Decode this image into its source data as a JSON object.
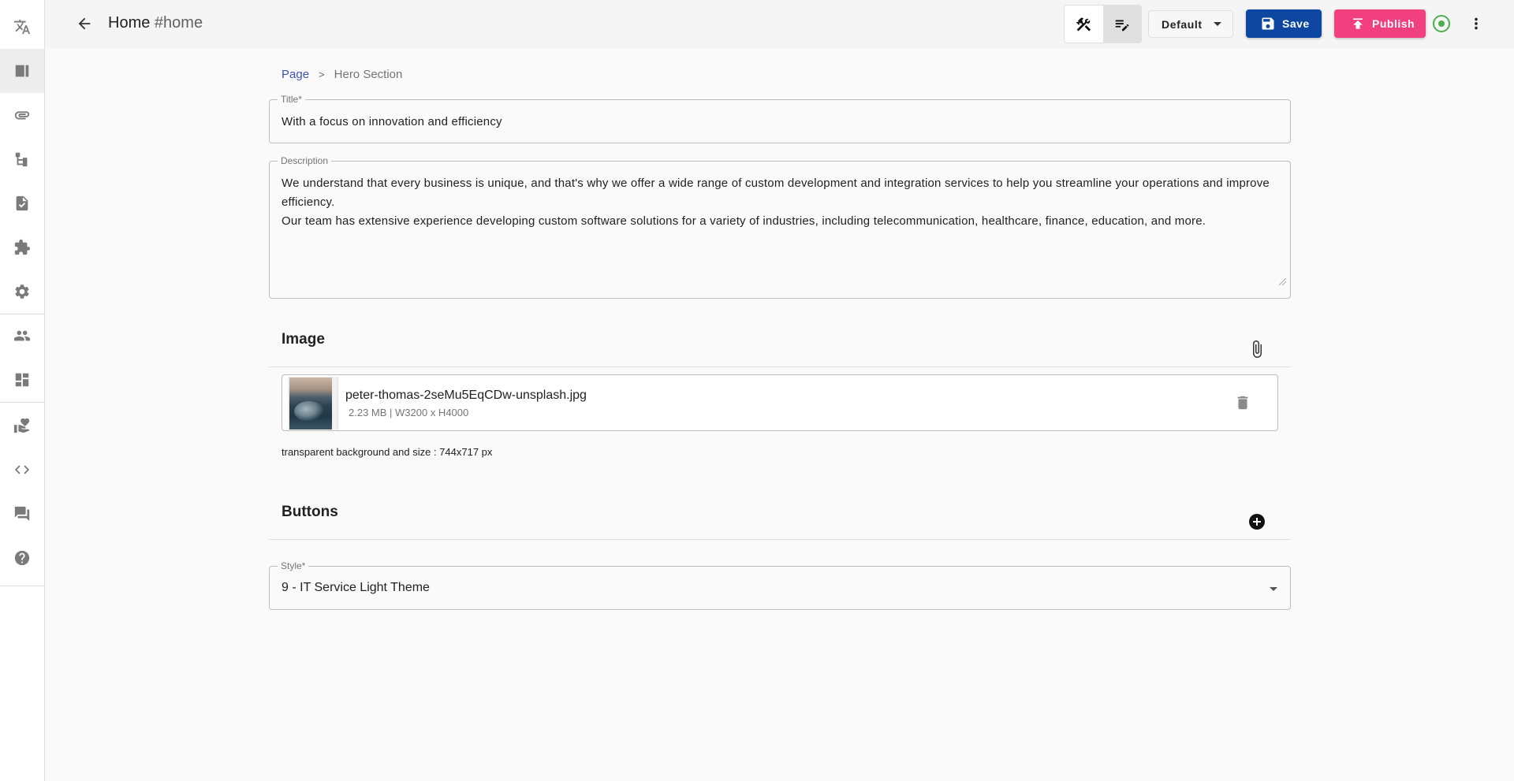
{
  "sidebar": {
    "items": [
      {
        "icon": "translate-icon"
      },
      {
        "icon": "pages-icon"
      },
      {
        "icon": "attachment-icon"
      },
      {
        "icon": "sitemap-icon"
      },
      {
        "icon": "form-check-icon"
      },
      {
        "icon": "puzzle-icon"
      },
      {
        "icon": "gear-icon"
      },
      {
        "icon": "users-icon"
      },
      {
        "icon": "dashboard-icon"
      },
      {
        "icon": "volunteer-icon"
      },
      {
        "icon": "code-icon"
      },
      {
        "icon": "chat-icon"
      },
      {
        "icon": "help-icon"
      }
    ],
    "active_index": 1
  },
  "header": {
    "title": "Home",
    "hash": "#home",
    "variant_select": "Default",
    "save_label": "Save",
    "publish_label": "Publish",
    "colors": {
      "save": "#0d47a1",
      "publish": "#f23f7e",
      "status": "#4caf50"
    }
  },
  "breadcrumb": {
    "root": "Page",
    "separator": ">",
    "current": "Hero Section"
  },
  "form": {
    "title": {
      "label": "Title*",
      "value": "With a focus on innovation and efficiency"
    },
    "description": {
      "label": "Description",
      "line1": "We understand that every business is unique, and that's why we offer a wide range of custom development and integration services to help you streamline your operations and improve efficiency.",
      "line2": "Our team has extensive experience developing custom software solutions for a variety of industries, including telecommunication, healthcare, finance, education, and more."
    },
    "image": {
      "section_title": "Image",
      "file_name": "peter-thomas-2seMu5EqCDw-unsplash.jpg",
      "file_meta": "2.23 MB | W3200 x H4000",
      "helper": "transparent background and size : 744x717 px"
    },
    "buttons": {
      "section_title": "Buttons"
    },
    "style": {
      "label": "Style*",
      "value": "9 - IT Service Light Theme"
    }
  }
}
